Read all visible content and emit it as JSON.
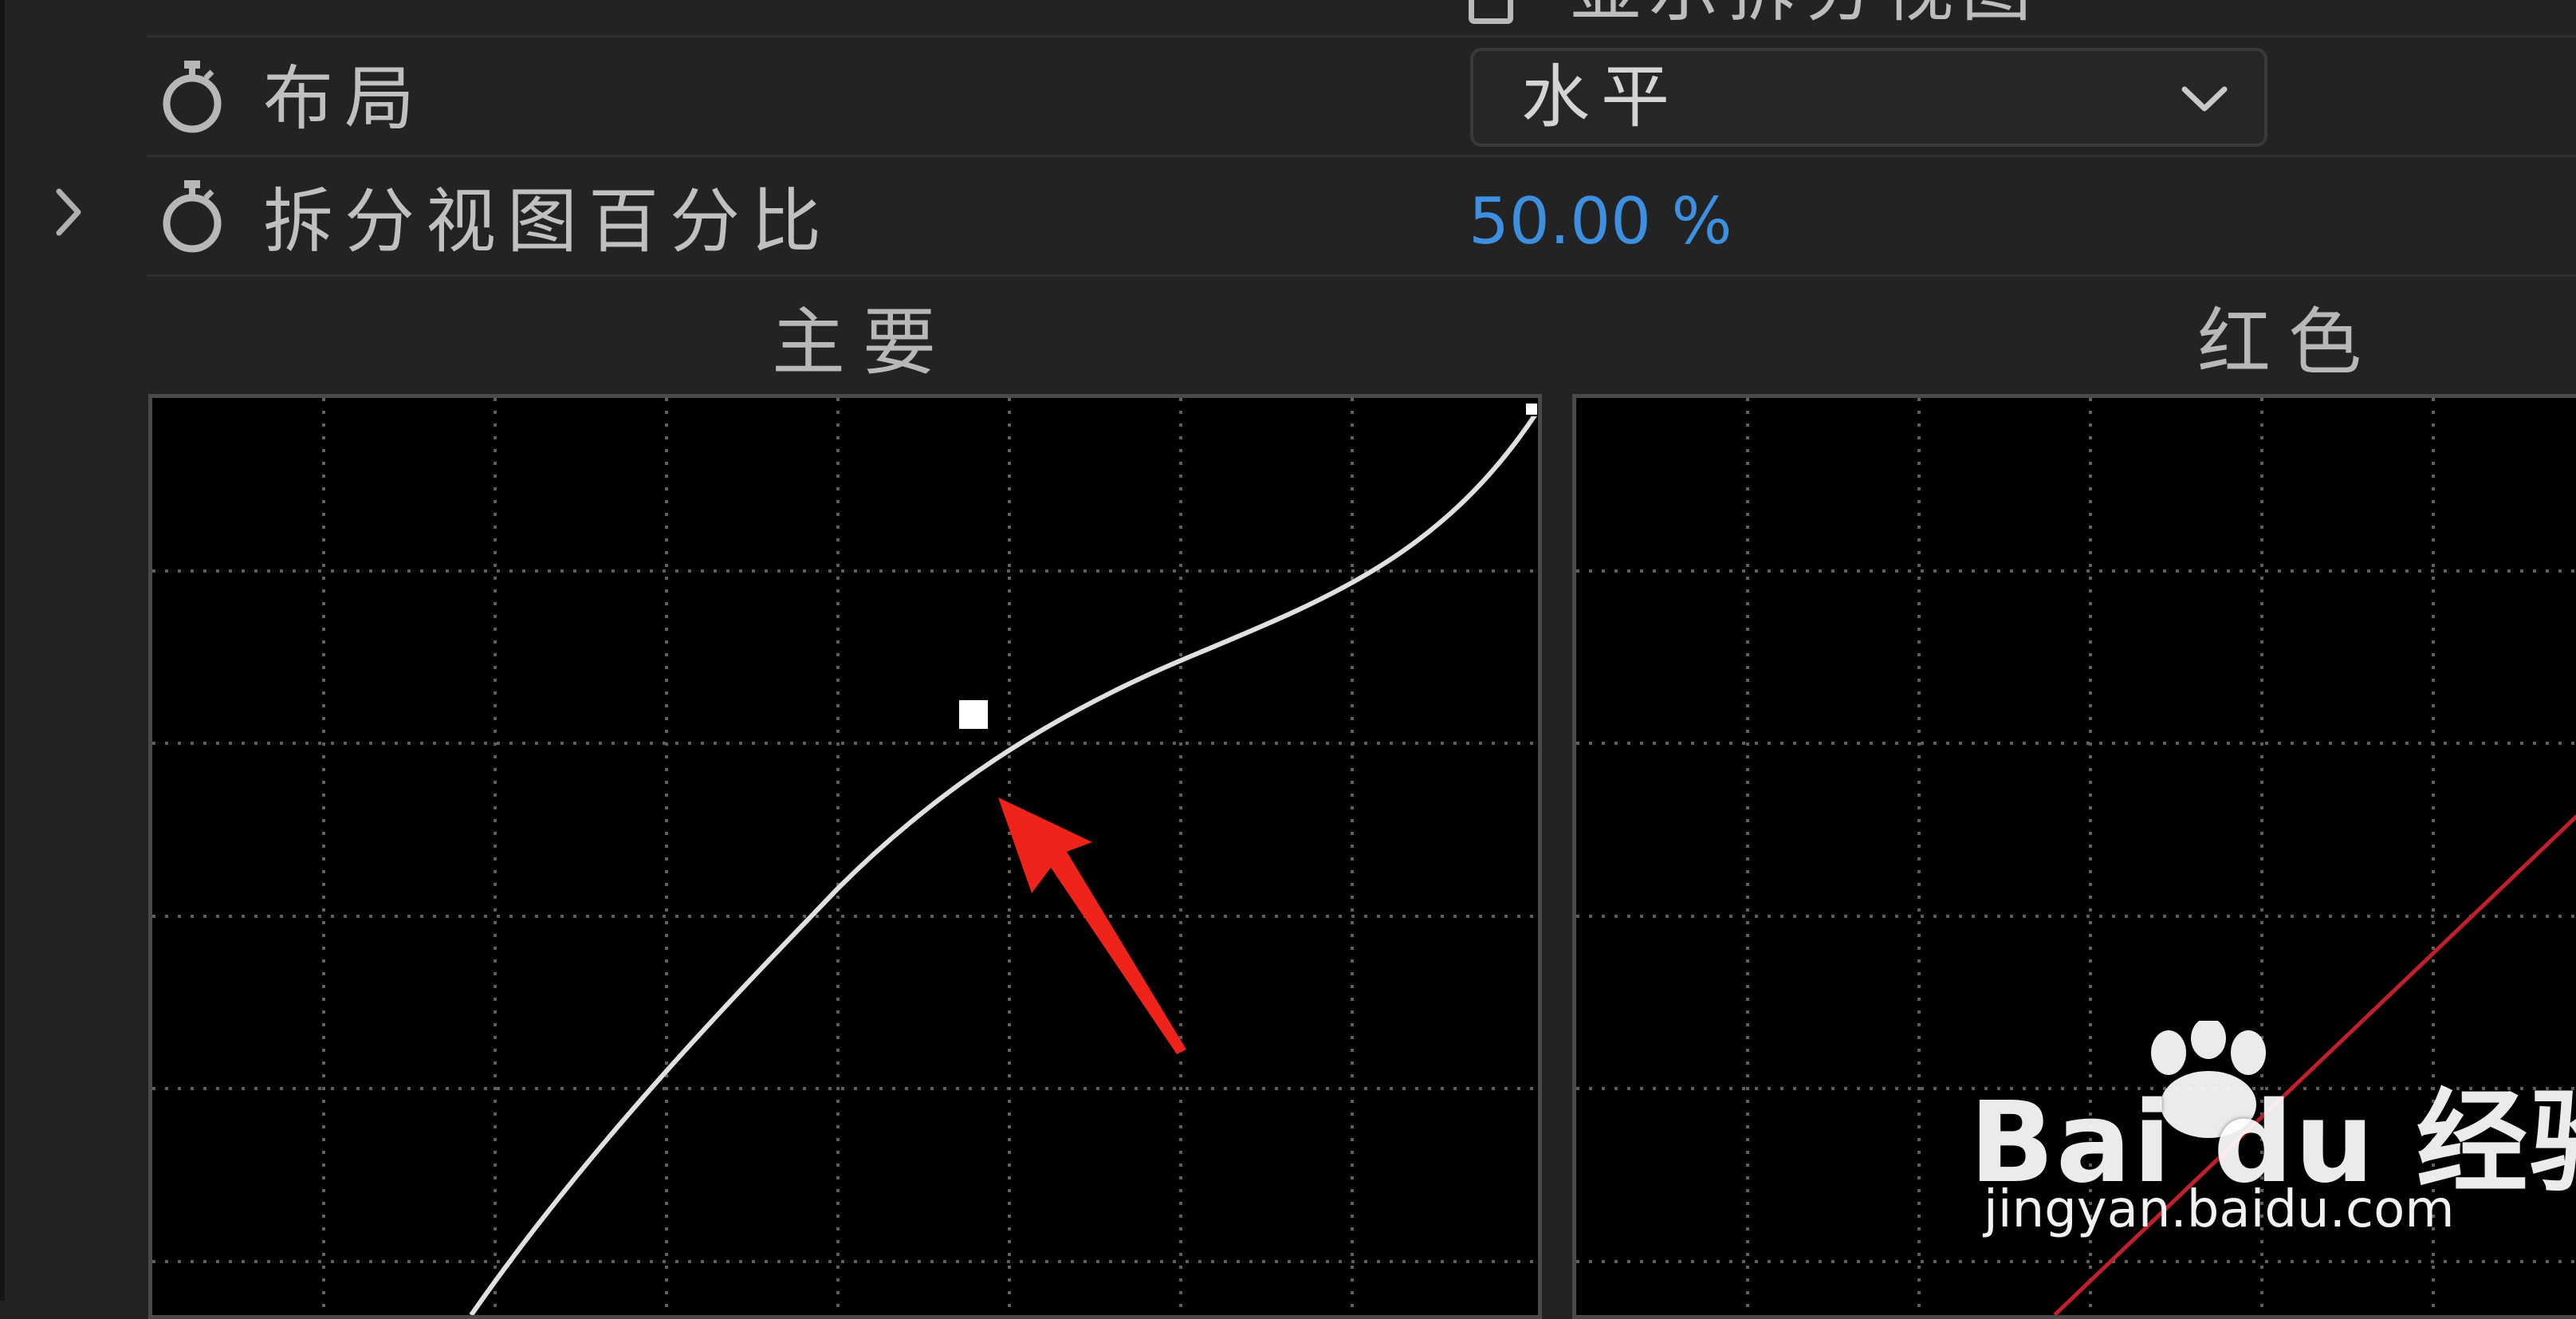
{
  "split_view": {
    "checkbox_label": "显示拆分视图",
    "checked": false
  },
  "layout": {
    "label": "布局",
    "dropdown_value": "水平"
  },
  "split_percentage": {
    "label": "拆分视图百分比",
    "value": "50.00 %"
  },
  "curves": {
    "main_title": "主要",
    "red_title": "红色"
  },
  "watermark": {
    "brand": "Bai du 经验",
    "url": "jingyan.baidu.com"
  },
  "icons": {
    "stopwatch": "stopwatch-icon",
    "dropdown": "chevron-down-icon",
    "disclosure": "chevron-right-icon",
    "annotation": "red-arrow-icon"
  },
  "colors": {
    "panel_bg": "#232323",
    "graph_bg": "#000000",
    "value_blue": "#3d8fe0",
    "red_channel": "#c0202a",
    "annotation_red": "#f0231b"
  }
}
